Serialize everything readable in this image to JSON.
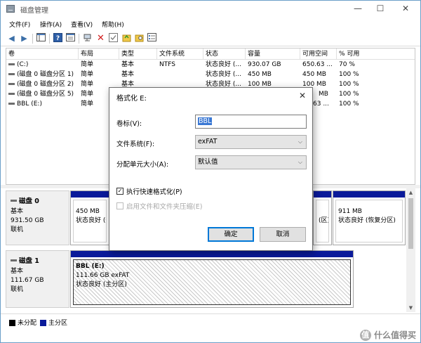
{
  "window": {
    "title": "磁盘管理",
    "controls": {
      "minimize": "—",
      "maximize": "☐",
      "close": "✕"
    }
  },
  "menu": [
    "文件(F)",
    "操作(A)",
    "查看(V)",
    "帮助(H)"
  ],
  "toolbar": {
    "icons": [
      "back-arrow-icon",
      "forward-arrow-icon",
      "console-tree-icon",
      "help-icon",
      "properties-icon",
      "connect-icon",
      "delete-icon",
      "check-icon",
      "folder-up-icon",
      "search-folder-icon",
      "list-icon"
    ]
  },
  "volume_table": {
    "columns": [
      "卷",
      "布局",
      "类型",
      "文件系统",
      "状态",
      "容量",
      "可用空间",
      "% 可用"
    ],
    "rows": [
      [
        "(C:)",
        "简单",
        "基本",
        "NTFS",
        "状态良好 (...",
        "930.07 GB",
        "650.63 ...",
        "70 %"
      ],
      [
        "(磁盘 0 磁盘分区 1)",
        "简单",
        "基本",
        "",
        "状态良好 (...",
        "450 MB",
        "450 MB",
        "100 %"
      ],
      [
        "(磁盘 0 磁盘分区 2)",
        "简单",
        "基本",
        "",
        "状态良好 (...",
        "100 MB",
        "100 MB",
        "100 %"
      ],
      [
        "(磁盘 0 磁盘分区 5)",
        "简单",
        "基本",
        "",
        "",
        "",
        "MB",
        "100 %"
      ],
      [
        "BBL (E:)",
        "简单",
        "基本",
        "",
        "",
        "",
        "63 ...",
        "100 %"
      ]
    ]
  },
  "disks": [
    {
      "name": "磁盘 0",
      "type": "基本",
      "size": "931.50 GB",
      "status": "联机",
      "partitions": [
        {
          "size": "450 MB",
          "status": "状态良好 (恢"
        },
        {
          "size": "",
          "status": "(区)"
        },
        {
          "size": "911 MB",
          "status": "状态良好 (恢复分区)"
        }
      ]
    },
    {
      "name": "磁盘 1",
      "type": "基本",
      "size": "111.67 GB",
      "status": "联机",
      "partitions": [
        {
          "label": "BBL (E:)",
          "size": "111.66 GB exFAT",
          "status": "状态良好 (主分区)"
        }
      ]
    }
  ],
  "legend": [
    {
      "label": "未分配",
      "color": "#000000"
    },
    {
      "label": "主分区",
      "color": "#0a1a9a"
    }
  ],
  "dialog": {
    "title": "格式化 E:",
    "close": "✕",
    "volume_label": {
      "label": "卷标(V):",
      "value": "BBL"
    },
    "file_system": {
      "label": "文件系统(F):",
      "value": "exFAT"
    },
    "allocation_unit": {
      "label": "分配单元大小(A):",
      "value": "默认值"
    },
    "quick_format": {
      "label": "执行快速格式化(P)",
      "checked": true
    },
    "compression": {
      "label": "启用文件和文件夹压缩(E)",
      "checked": false,
      "disabled": true
    },
    "ok": "确定",
    "cancel": "取消"
  },
  "watermark": {
    "glyph": "值",
    "text": "什么值得买"
  },
  "colors": {
    "primary_partition": "#0a1a9a",
    "accent": "#0078d7",
    "selection": "#3a78d4"
  }
}
